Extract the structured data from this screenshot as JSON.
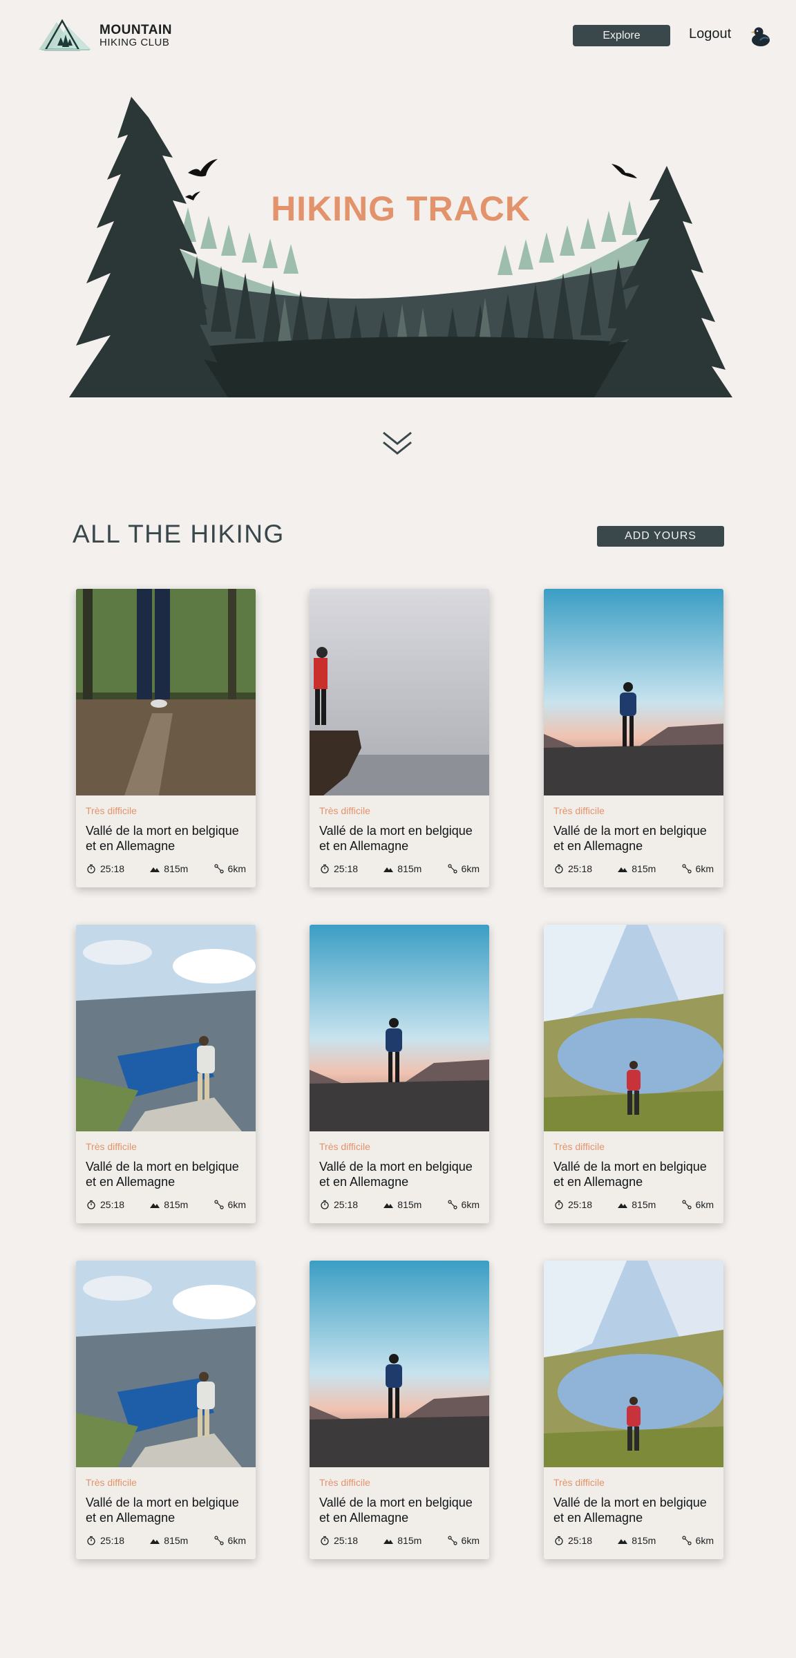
{
  "header": {
    "logo_title": "MOUNTAIN",
    "logo_subtitle": "HIKING CLUB",
    "explore_label": "Explore",
    "logout_label": "Logout"
  },
  "hero": {
    "title": "HIKING TRACK"
  },
  "section": {
    "title": "ALL THE HIKING",
    "add_label": "ADD YOURS"
  },
  "colors": {
    "accent": "#e3936b",
    "dark": "#3a474b",
    "background": "#f3f0ed"
  },
  "icons": {
    "duration": "stopwatch-icon",
    "elevation": "mountain-icon",
    "distance": "route-icon"
  },
  "hikes": [
    {
      "image": "forest-log-photo",
      "difficulty": "Très difficile",
      "title": "Vallé de la mort en belgique et en Allemagne",
      "duration": "25:18",
      "elevation": "815m",
      "distance": "6km"
    },
    {
      "image": "misty-cliff-photo",
      "difficulty": "Très difficile",
      "title": "Vallé de la mort en belgique et en Allemagne",
      "duration": "25:18",
      "elevation": "815m",
      "distance": "6km"
    },
    {
      "image": "sunset-ridge-photo",
      "difficulty": "Très difficile",
      "title": "Vallé de la mort en belgique et en Allemagne",
      "duration": "25:18",
      "elevation": "815m",
      "distance": "6km"
    },
    {
      "image": "fjord-photo",
      "difficulty": "Très difficile",
      "title": "Vallé de la mort en belgique et en Allemagne",
      "duration": "25:18",
      "elevation": "815m",
      "distance": "6km"
    },
    {
      "image": "sunset-ridge-photo",
      "difficulty": "Très difficile",
      "title": "Vallé de la mort en belgique et en Allemagne",
      "duration": "25:18",
      "elevation": "815m",
      "distance": "6km"
    },
    {
      "image": "alpine-lake-photo",
      "difficulty": "Très difficile",
      "title": "Vallé de la mort en belgique et en Allemagne",
      "duration": "25:18",
      "elevation": "815m",
      "distance": "6km"
    },
    {
      "image": "fjord-photo",
      "difficulty": "Très difficile",
      "title": "Vallé de la mort en belgique et en Allemagne",
      "duration": "25:18",
      "elevation": "815m",
      "distance": "6km"
    },
    {
      "image": "sunset-ridge-photo",
      "difficulty": "Très difficile",
      "title": "Vallé de la mort en belgique et en Allemagne",
      "duration": "25:18",
      "elevation": "815m",
      "distance": "6km"
    },
    {
      "image": "alpine-lake-photo",
      "difficulty": "Très difficile",
      "title": "Vallé de la mort en belgique et en Allemagne",
      "duration": "25:18",
      "elevation": "815m",
      "distance": "6km"
    }
  ]
}
